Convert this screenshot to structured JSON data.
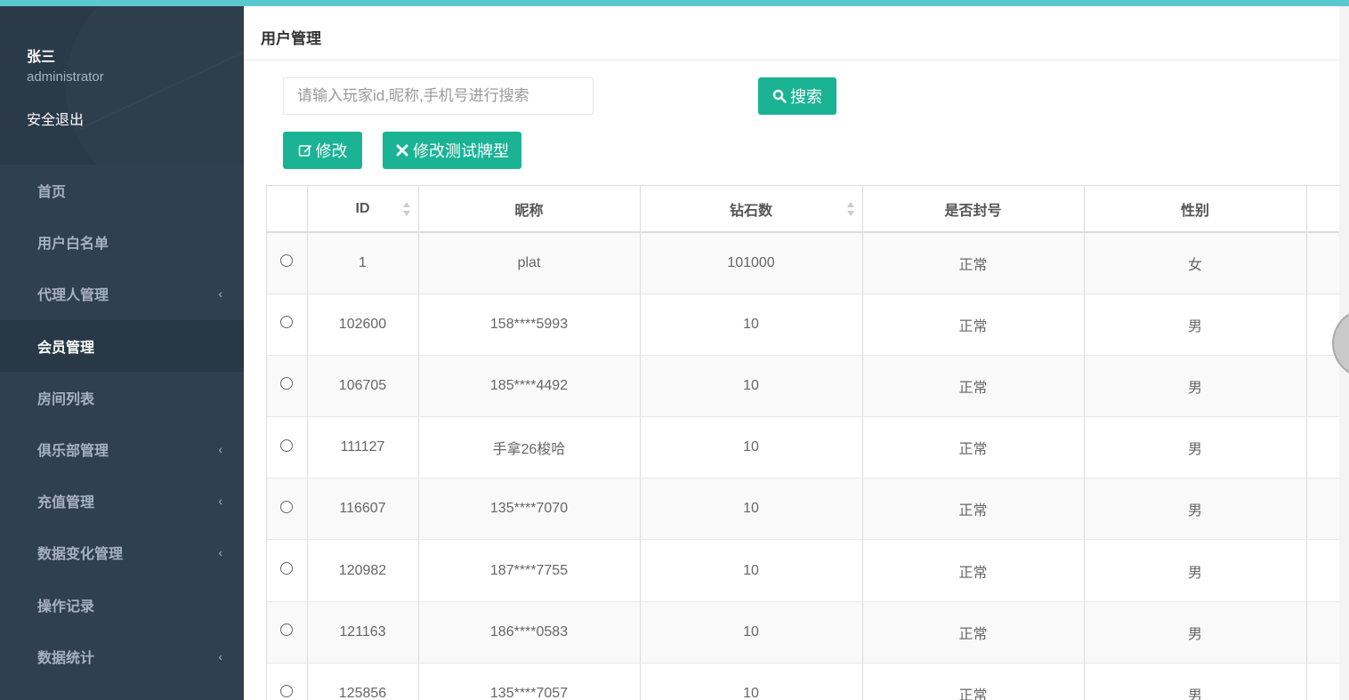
{
  "sidebar": {
    "user_name": "张三",
    "user_role": "administrator",
    "logout": "安全退出",
    "items": [
      {
        "label": "首页",
        "has_submenu": false
      },
      {
        "label": "用户白名单",
        "has_submenu": false
      },
      {
        "label": "代理人管理",
        "has_submenu": true
      },
      {
        "label": "会员管理",
        "has_submenu": false,
        "active": true
      },
      {
        "label": "房间列表",
        "has_submenu": false
      },
      {
        "label": "俱乐部管理",
        "has_submenu": true
      },
      {
        "label": "充值管理",
        "has_submenu": true
      },
      {
        "label": "数据变化管理",
        "has_submenu": true
      },
      {
        "label": "操作记录",
        "has_submenu": false
      },
      {
        "label": "数据统计",
        "has_submenu": true
      }
    ],
    "arrow": "‹"
  },
  "page": {
    "title": "用户管理"
  },
  "search": {
    "placeholder": "请输入玩家id,昵称,手机号进行搜索",
    "value": "",
    "button_label": "搜索"
  },
  "toolbar": {
    "edit_label": "修改",
    "edit_test_label": "修改测试牌型"
  },
  "table": {
    "columns": [
      "",
      "ID",
      "昵称",
      "钻石数",
      "是否封号",
      "性别",
      ""
    ],
    "rows": [
      {
        "id": "1",
        "nickname": "plat",
        "diamonds": "101000",
        "status": "正常",
        "gender": "女"
      },
      {
        "id": "102600",
        "nickname": "158****5993",
        "diamonds": "10",
        "status": "正常",
        "gender": "男"
      },
      {
        "id": "106705",
        "nickname": "185****4492",
        "diamonds": "10",
        "status": "正常",
        "gender": "男"
      },
      {
        "id": "111127",
        "nickname": "手拿26梭哈",
        "diamonds": "10",
        "status": "正常",
        "gender": "男"
      },
      {
        "id": "116607",
        "nickname": "135****7070",
        "diamonds": "10",
        "status": "正常",
        "gender": "男"
      },
      {
        "id": "120982",
        "nickname": "187****7755",
        "diamonds": "10",
        "status": "正常",
        "gender": "男"
      },
      {
        "id": "121163",
        "nickname": "186****0583",
        "diamonds": "10",
        "status": "正常",
        "gender": "男"
      },
      {
        "id": "125856",
        "nickname": "135****7057",
        "diamonds": "10",
        "status": "正常",
        "gender": "男"
      }
    ]
  },
  "colors": {
    "accent": "#1ab394",
    "sidebar_bg": "#2f4050",
    "top_bar": "#5bc8d0"
  }
}
